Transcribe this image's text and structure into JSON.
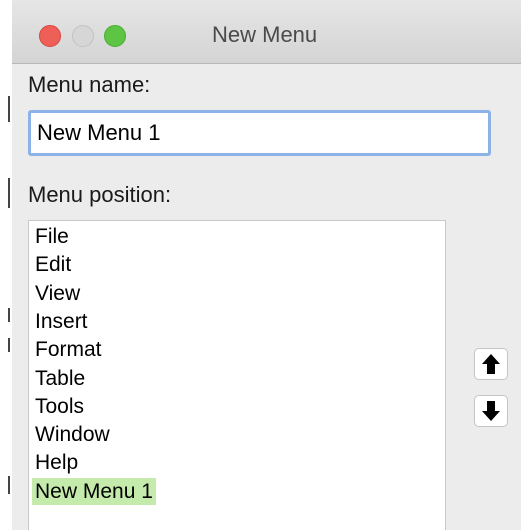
{
  "window": {
    "title": "New Menu"
  },
  "form": {
    "menu_name_label": "Menu name:",
    "menu_name_value": "New Menu 1",
    "menu_position_label": "Menu position:"
  },
  "menu_positions": [
    "File",
    "Edit",
    "View",
    "Insert",
    "Format",
    "Table",
    "Tools",
    "Window",
    "Help",
    "New Menu 1"
  ],
  "selected_index": 9,
  "icons": {
    "move_up": "arrow-up-icon",
    "move_down": "arrow-down-icon"
  },
  "colors": {
    "selection": "#c5ebac",
    "focus_ring": "#8db2e8",
    "close": "#ee5f58",
    "zoom": "#5ec443"
  }
}
